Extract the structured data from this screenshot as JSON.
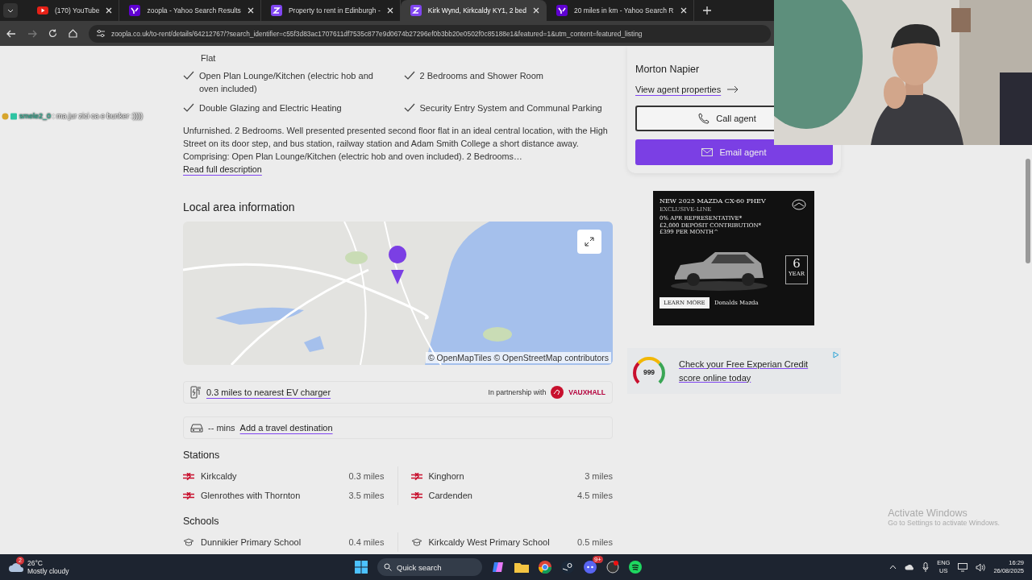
{
  "browser": {
    "tabs": [
      {
        "kind": "youtube",
        "title": "(170) YouTube",
        "selected": false
      },
      {
        "kind": "yahoo",
        "title": "zoopla - Yahoo Search Results",
        "selected": false
      },
      {
        "kind": "zoopla",
        "title": "Property to rent in Edinburgh -",
        "selected": false
      },
      {
        "kind": "zoopla",
        "title": "Kirk Wynd, Kirkcaldy KY1, 2 bed",
        "selected": true
      },
      {
        "kind": "yahoo",
        "title": "20 miles in km - Yahoo Search R",
        "selected": false
      }
    ],
    "url": "zoopla.co.uk/to-rent/details/64212767/?search_identifier=c55f3d83ac1707611df7535c877e9d0674b27296ef0b3bb20e0502f0c85188e1&featured=1&utm_content=featured_listing"
  },
  "stream_overlay": {
    "chat_user": "smele2_0",
    "chat_message": ": ma jur zici ca e bunker :))))"
  },
  "features": {
    "continuation": "Flat",
    "items": [
      {
        "text": "Open Plan Lounge/Kitchen (electric hob and oven included)"
      },
      {
        "text": "2 Bedrooms and Shower Room"
      },
      {
        "text": "Double Glazing and Electric Heating"
      },
      {
        "text": "Security Entry System and Communal Parking"
      }
    ]
  },
  "description": {
    "text": "Unfurnished. 2 Bedrooms. Well presented presented second floor flat in an ideal central location, with the High Street on its door step, and bus station, railway station and Adam Smith College a short distance away. Comprising: Open Plan Lounge/Kitchen (electric hob and oven included). 2 Bedrooms…",
    "link": "Read full description"
  },
  "local_area": {
    "title": "Local area information",
    "map_attribution": "© OpenMapTiles © OpenStreetMap contributors",
    "ev_charger": "0.3 miles to nearest EV charger",
    "partner_label": "In partnership with",
    "partner": "VAUXHALL",
    "travel_prefix": "-- mins",
    "travel_link": "Add a travel destination"
  },
  "stations": {
    "title": "Stations",
    "items": [
      {
        "name": "Kirkcaldy",
        "distance": "0.3 miles"
      },
      {
        "name": "Kinghorn",
        "distance": "3 miles"
      },
      {
        "name": "Glenrothes with Thornton",
        "distance": "3.5 miles"
      },
      {
        "name": "Cardenden",
        "distance": "4.5 miles"
      }
    ]
  },
  "schools": {
    "title": "Schools",
    "items": [
      {
        "name": "Dunnikier Primary School",
        "distance": "0.4 miles"
      },
      {
        "name": "Kirkcaldy West Primary School",
        "distance": "0.5 miles"
      }
    ]
  },
  "agent": {
    "name": "Morton Napier",
    "link": "View agent properties",
    "call": "Call agent",
    "email": "Email agent"
  },
  "ad": {
    "headline": "NEW 2025 MAZDA CX-60 PHEV",
    "subline": "EXCLUSIVE-LINE",
    "offers": [
      "0% APR REPRESENTATIVE*",
      "£2,000 DEPOSIT CONTRIBUTION*",
      "£399 PER MONTH^"
    ],
    "badge_number": "6",
    "badge_word": "YEAR",
    "button": "LEARN MORE",
    "dealer": "Donalds Mazda"
  },
  "credit": {
    "score": "999",
    "text": "Check your Free Experian Credit score online today"
  },
  "windows_notice": {
    "title": "Activate Windows",
    "subtitle": "Go to Settings to activate Windows."
  },
  "taskbar": {
    "weather_badge": "2",
    "temperature": "26°C",
    "weather": "Mostly cloudy",
    "search": "Quick search",
    "notification_badge": "9+",
    "language": "ENG",
    "region": "US",
    "time": "16:29",
    "date": "26/08/2025"
  }
}
